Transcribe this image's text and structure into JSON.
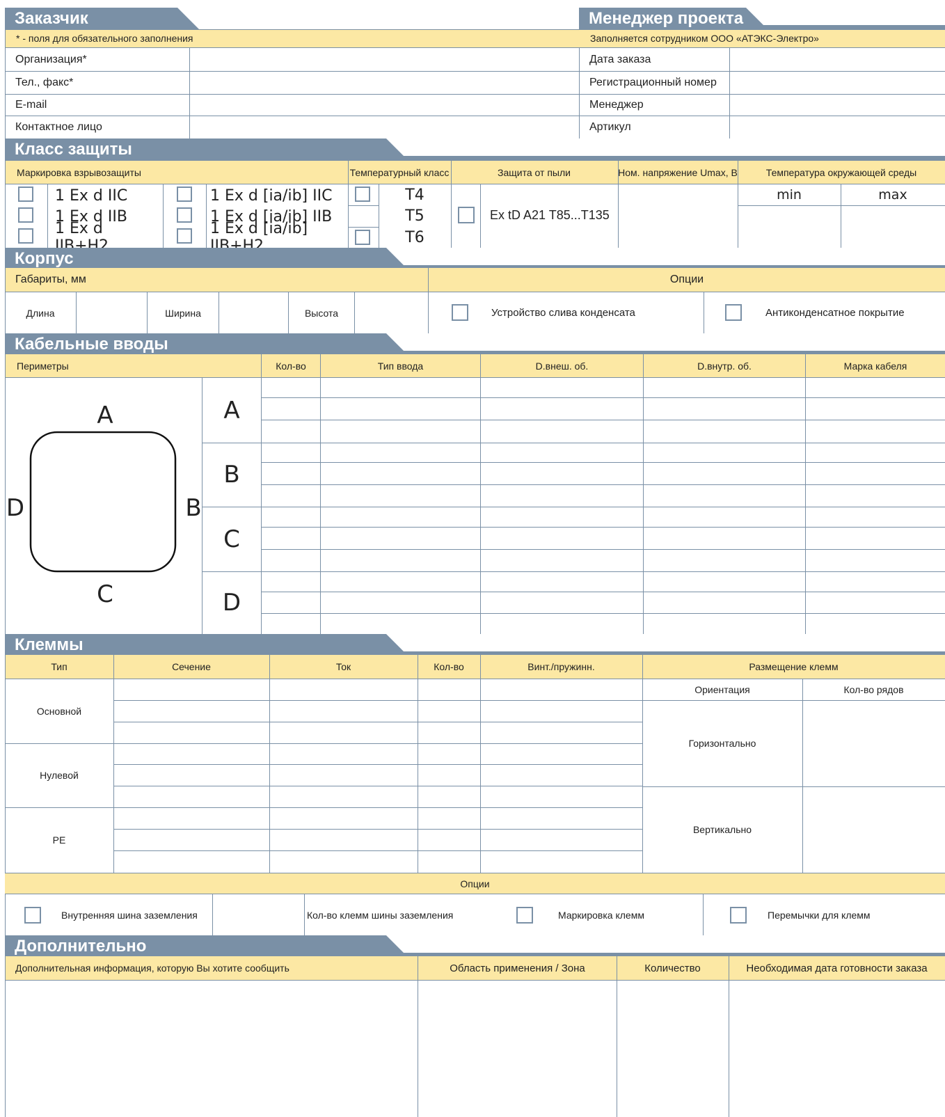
{
  "customer": {
    "title": "Заказчик",
    "note": "* - поля для обязательного заполнения",
    "fields": [
      "Организация*",
      "Тел., факс*",
      "E-mail",
      "Контактное лицо"
    ]
  },
  "manager": {
    "title": "Менеджер проекта",
    "note": "Заполняется сотрудником ООО «АТЭКС-Электро»",
    "fields": [
      "Дата заказа",
      "Регистрационный номер",
      "Менеджер",
      "Артикул"
    ]
  },
  "protection": {
    "title": "Класс защиты",
    "headers": [
      "Маркировка взрывозащиты",
      "Температурный класс",
      "Защита от пыли",
      "Ном. напряжение Umax, В",
      "Температура окружающей среды"
    ],
    "markings_left": [
      "1 Ex d IIC",
      "1 Ex d IIB",
      "1 Ex d IIB+H2"
    ],
    "markings_right": [
      "1 Ex d [ia/ib] IIC",
      "1 Ex d [ia/ib] IIB",
      "1 Ex d [ia/ib] IIB+H2"
    ],
    "temp_classes": [
      "T4",
      "T5",
      "T6"
    ],
    "dust": "Ex tD A21  T85...T135",
    "temp_min": "min",
    "temp_max": "max"
  },
  "housing": {
    "title": "Корпус",
    "dims_label": "Габариты,  мм",
    "options_label": "Опции",
    "length": "Длина",
    "width": "Ширина",
    "height": "Высота",
    "opt1": "Устройство слива конденсата",
    "opt2": "Антиконденсатное покрытие"
  },
  "cables": {
    "title": "Кабельные вводы",
    "headers": [
      "Периметры",
      "Кол-во",
      "Тип ввода",
      "D.внеш. об.",
      "D.внутр. об.",
      "Марка кабеля"
    ],
    "sides": [
      "A",
      "B",
      "C",
      "D"
    ],
    "diagram": {
      "top": "A",
      "right": "B",
      "bottom": "C",
      "left": "D"
    }
  },
  "terminals": {
    "title": "Клеммы",
    "headers": [
      "Тип",
      "Сечение",
      "Ток",
      "Кол-во",
      "Винт./пружинн.",
      "Размещение клемм"
    ],
    "sub_headers": [
      "Ориентация",
      "Кол-во рядов"
    ],
    "types": [
      "Основной",
      "Нулевой",
      "PE"
    ],
    "orientations": [
      "Горизонтально",
      "Вертикально"
    ],
    "options_label": "Опции",
    "opt1": "Внутренняя шина заземления",
    "opt2": "Кол-во клемм шины заземления",
    "opt3": "Маркировка клемм",
    "opt4": "Перемычки для клемм"
  },
  "extra": {
    "title": "Дополнительно",
    "headers": [
      "Дополнительная информация, которую Вы хотите сообщить",
      "Область применения / Зона",
      "Количество",
      "Необходимая дата готовности заказа"
    ]
  }
}
